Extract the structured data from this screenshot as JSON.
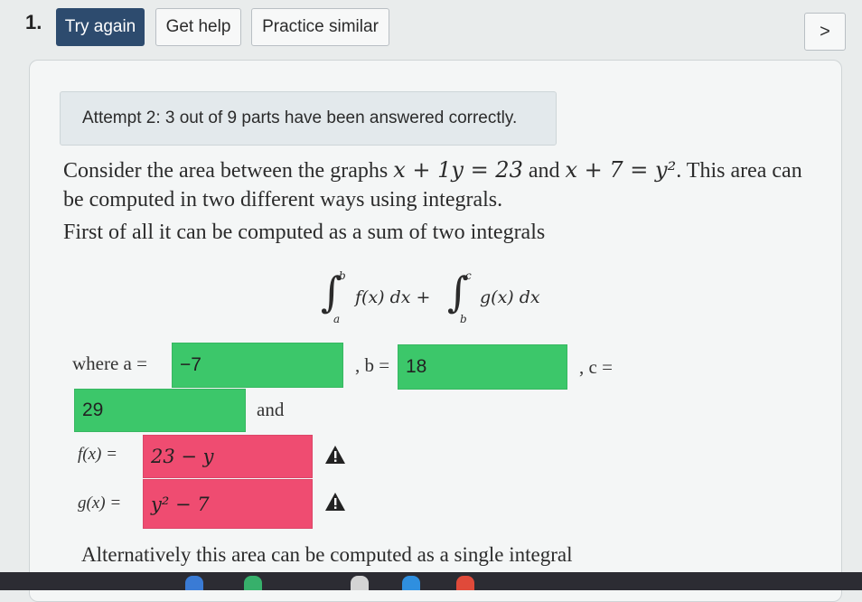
{
  "question": {
    "number": "1.",
    "buttons": {
      "try_again": "Try again",
      "get_help": "Get help",
      "practice_similar": "Practice similar",
      "next": ">"
    }
  },
  "attempt_message": "Attempt 2: 3 out of 9 parts have been answered correctly.",
  "problem": {
    "line1_a": "Consider the area between the graphs ",
    "eq1": "x + 1y = 23",
    "line1_b": " and ",
    "eq2": "x + 7 = y²",
    "line1_c": ". This area can",
    "line2": "be computed in two different ways using integrals.",
    "line3": "First of all it can be computed as a sum of two integrals",
    "integral": {
      "upper1": "b",
      "lower1": "a",
      "integrand1": "f(x) dx +",
      "upper2": "c",
      "lower2": "b",
      "integrand2": "g(x) dx"
    },
    "line_alt": "Alternatively this area can be computed as a single integral"
  },
  "answers": {
    "where_a_label": "where a =",
    "a_value": "−7",
    "b_label": ", b =",
    "b_value": "18",
    "c_label": ", c =",
    "c_value": "29",
    "and_label": "and",
    "f_label": "f(x) =",
    "f_value": "23 − y",
    "g_label": "g(x) =",
    "g_value": "y² − 7"
  },
  "colors": {
    "correct": "#3cc76a",
    "incorrect": "#ef4c71",
    "primary": "#2d4b6e"
  }
}
